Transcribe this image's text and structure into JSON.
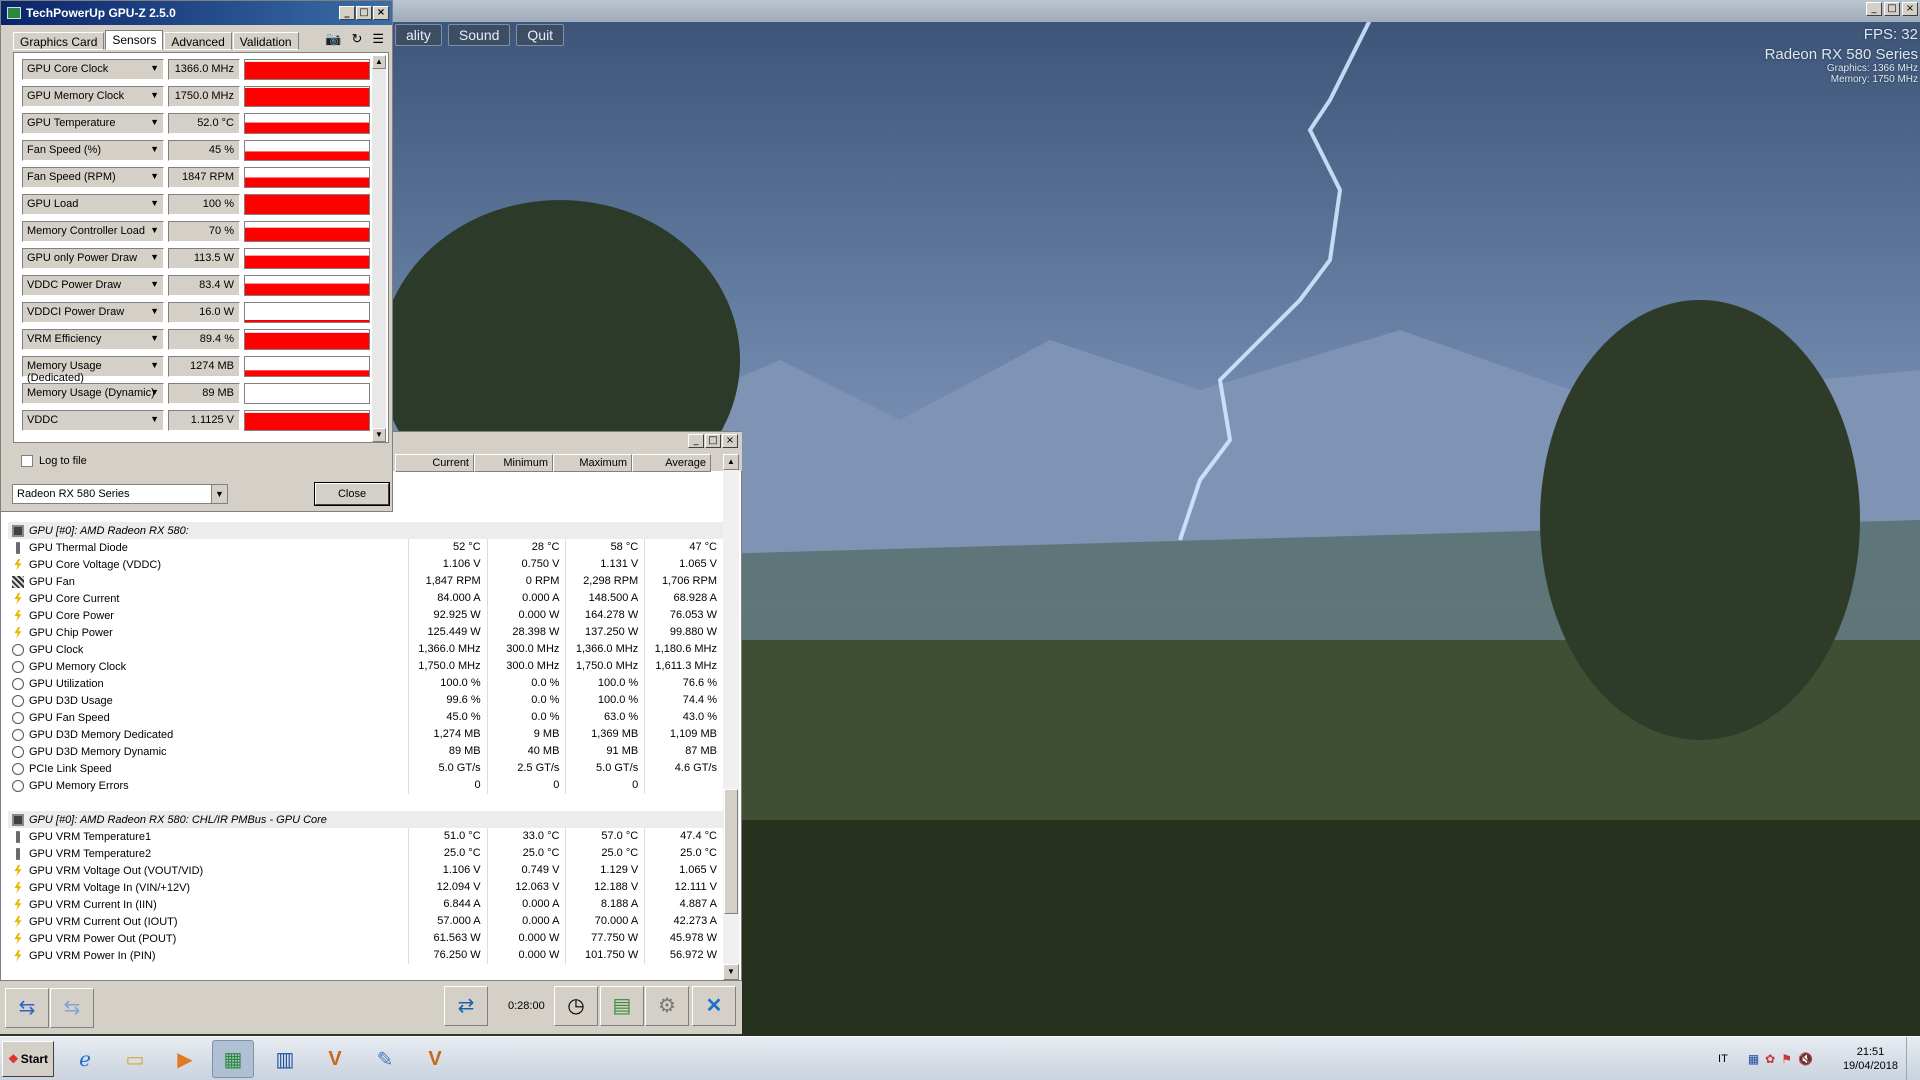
{
  "game": {
    "menu": [
      "ality",
      "Sound",
      "Quit"
    ],
    "fps": "FPS: 32",
    "gpu_name": "Radeon RX 580 Series",
    "graphics_line": "Graphics: 1366 MHz",
    "memory_line": "Memory: 1750 MHz"
  },
  "gpuz": {
    "title": "TechPowerUp GPU-Z 2.5.0",
    "tabs": [
      "Graphics Card",
      "Sensors",
      "Advanced",
      "Validation"
    ],
    "active_tab": "Sensors",
    "sensors": [
      {
        "name": "GPU Core Clock",
        "value": "1366.0 MHz",
        "fill": 0.9
      },
      {
        "name": "GPU Memory Clock",
        "value": "1750.0 MHz",
        "fill": 0.95
      },
      {
        "name": "GPU Temperature",
        "value": "52.0 °C",
        "fill": 0.55
      },
      {
        "name": "Fan Speed (%)",
        "value": "45 %",
        "fill": 0.45
      },
      {
        "name": "Fan Speed (RPM)",
        "value": "1847 RPM",
        "fill": 0.5
      },
      {
        "name": "GPU Load",
        "value": "100 %",
        "fill": 1.0
      },
      {
        "name": "Memory Controller Load",
        "value": "70 %",
        "fill": 0.7
      },
      {
        "name": "GPU only Power Draw",
        "value": "113.5 W",
        "fill": 0.65
      },
      {
        "name": "VDDC Power Draw",
        "value": "83.4 W",
        "fill": 0.6
      },
      {
        "name": "VDDCI Power Draw",
        "value": "16.0 W",
        "fill": 0.1
      },
      {
        "name": "VRM Efficiency",
        "value": "89.4 %",
        "fill": 0.85
      },
      {
        "name": "Memory Usage (Dedicated)",
        "value": "1274 MB",
        "fill": 0.3
      },
      {
        "name": "Memory Usage (Dynamic)",
        "value": "89 MB",
        "fill": 0.0
      },
      {
        "name": "VDDC",
        "value": "1.1125 V",
        "fill": 0.9
      }
    ],
    "log_label": "Log to file",
    "device": "Radeon RX 580 Series",
    "close_label": "Close",
    "accent": "#ff0000"
  },
  "hwinfo": {
    "columns": [
      "Current",
      "Minimum",
      "Maximum",
      "Average"
    ],
    "groups": [
      {
        "title": "GPU [#0]: AMD Radeon RX 580:",
        "rows": [
          {
            "icon": "therm",
            "label": "GPU Thermal Diode",
            "v": [
              "52 °C",
              "28 °C",
              "58 °C",
              "47 °C"
            ]
          },
          {
            "icon": "volt",
            "label": "GPU Core Voltage (VDDC)",
            "v": [
              "1.106 V",
              "0.750 V",
              "1.131 V",
              "1.065 V"
            ]
          },
          {
            "icon": "fan",
            "label": "GPU Fan",
            "v": [
              "1,847 RPM",
              "0 RPM",
              "2,298 RPM",
              "1,706 RPM"
            ]
          },
          {
            "icon": "volt",
            "label": "GPU Core Current",
            "v": [
              "84.000 A",
              "0.000 A",
              "148.500 A",
              "68.928 A"
            ]
          },
          {
            "icon": "volt",
            "label": "GPU Core Power",
            "v": [
              "92.925 W",
              "0.000 W",
              "164.278 W",
              "76.053 W"
            ]
          },
          {
            "icon": "volt",
            "label": "GPU Chip Power",
            "v": [
              "125.449 W",
              "28.398 W",
              "137.250 W",
              "99.880 W"
            ]
          },
          {
            "icon": "clock",
            "label": "GPU Clock",
            "v": [
              "1,366.0 MHz",
              "300.0 MHz",
              "1,366.0 MHz",
              "1,180.6 MHz"
            ]
          },
          {
            "icon": "clock",
            "label": "GPU Memory Clock",
            "v": [
              "1,750.0 MHz",
              "300.0 MHz",
              "1,750.0 MHz",
              "1,611.3 MHz"
            ]
          },
          {
            "icon": "clock",
            "label": "GPU Utilization",
            "v": [
              "100.0 %",
              "0.0 %",
              "100.0 %",
              "76.6 %"
            ]
          },
          {
            "icon": "clock",
            "label": "GPU D3D Usage",
            "v": [
              "99.6 %",
              "0.0 %",
              "100.0 %",
              "74.4 %"
            ]
          },
          {
            "icon": "clock",
            "label": "GPU Fan Speed",
            "v": [
              "45.0 %",
              "0.0 %",
              "63.0 %",
              "43.0 %"
            ]
          },
          {
            "icon": "clock",
            "label": "GPU D3D Memory Dedicated",
            "v": [
              "1,274 MB",
              "9 MB",
              "1,369 MB",
              "1,109 MB"
            ]
          },
          {
            "icon": "clock",
            "label": "GPU D3D Memory Dynamic",
            "v": [
              "89 MB",
              "40 MB",
              "91 MB",
              "87 MB"
            ]
          },
          {
            "icon": "clock",
            "label": "PCIe Link Speed",
            "v": [
              "5.0 GT/s",
              "2.5 GT/s",
              "5.0 GT/s",
              "4.6 GT/s"
            ]
          },
          {
            "icon": "clock",
            "label": "GPU Memory Errors",
            "v": [
              "0",
              "0",
              "0",
              ""
            ]
          }
        ]
      },
      {
        "title": "GPU [#0]: AMD Radeon RX 580: CHL/IR PMBus - GPU Core",
        "rows": [
          {
            "icon": "therm",
            "label": "GPU VRM Temperature1",
            "v": [
              "51.0 °C",
              "33.0 °C",
              "57.0 °C",
              "47.4 °C"
            ]
          },
          {
            "icon": "therm",
            "label": "GPU VRM Temperature2",
            "v": [
              "25.0 °C",
              "25.0 °C",
              "25.0 °C",
              "25.0 °C"
            ]
          },
          {
            "icon": "volt",
            "label": "GPU VRM Voltage Out (VOUT/VID)",
            "v": [
              "1.106 V",
              "0.749 V",
              "1.129 V",
              "1.065 V"
            ]
          },
          {
            "icon": "volt",
            "label": "GPU VRM Voltage In (VIN/+12V)",
            "v": [
              "12.094 V",
              "12.063 V",
              "12.188 V",
              "12.111 V"
            ]
          },
          {
            "icon": "volt",
            "label": "GPU VRM Current In (IIN)",
            "v": [
              "6.844 A",
              "0.000 A",
              "8.188 A",
              "4.887 A"
            ]
          },
          {
            "icon": "volt",
            "label": "GPU VRM Current Out (IOUT)",
            "v": [
              "57.000 A",
              "0.000 A",
              "70.000 A",
              "42.273 A"
            ]
          },
          {
            "icon": "volt",
            "label": "GPU VRM Power Out (POUT)",
            "v": [
              "61.563 W",
              "0.000 W",
              "77.750 W",
              "45.978 W"
            ]
          },
          {
            "icon": "volt",
            "label": "GPU VRM Power In (PIN)",
            "v": [
              "76.250 W",
              "0.000 W",
              "101.750 W",
              "56.972 W"
            ]
          }
        ]
      }
    ],
    "timer": "0:28:00"
  },
  "taskbar": {
    "start": "Start",
    "lang": "IT",
    "time": "21:51",
    "date": "19/04/2018"
  }
}
